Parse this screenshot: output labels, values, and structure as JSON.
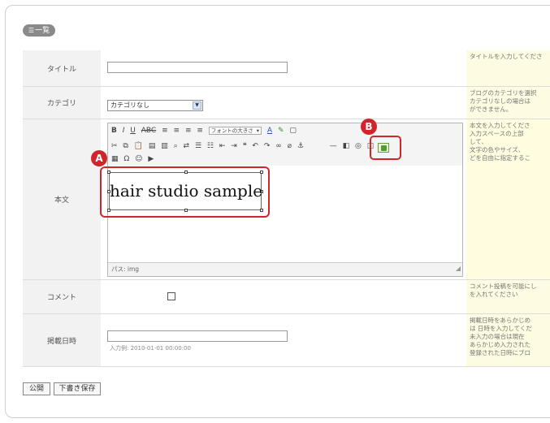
{
  "list_button": {
    "label": "一覧"
  },
  "form": {
    "title": {
      "label": "タイトル",
      "help": "タイトルを入力してくださ"
    },
    "category": {
      "label": "カテゴリ",
      "selected": "カテゴリなし",
      "help": "ブログのカテゴリを選択\nカテゴリなしの場合は\nができません。"
    },
    "body": {
      "label": "本文",
      "toolbar_font_size": "フォントの大きさ",
      "status_path": "パス: img",
      "content_text": "hair studio sample",
      "help": "本文を入力してくださ\n入力スペースの上部\nして、\n文字の色やサイズ、\nどを自由に指定するこ"
    },
    "comment": {
      "label": "コメント",
      "help": "コメント投稿を可能にし\nを入れてください"
    },
    "publish_date": {
      "label": "掲載日時",
      "hint": "入力例: 2010-01-01 00:00:00",
      "help": "掲載日時をあらかじめ\nは 日時を入力してくだ\n未入力の場合は現在\nあらかじめ入力された\n登録された日時にブロ"
    }
  },
  "callouts": {
    "a": "A",
    "b": "B"
  },
  "buttons": {
    "publish": "公開",
    "draft": "下書き保存"
  },
  "colors": {
    "highlight": "#d0262b",
    "help_bg": "#fdfbe1",
    "label_bg": "#f2f2f2"
  }
}
